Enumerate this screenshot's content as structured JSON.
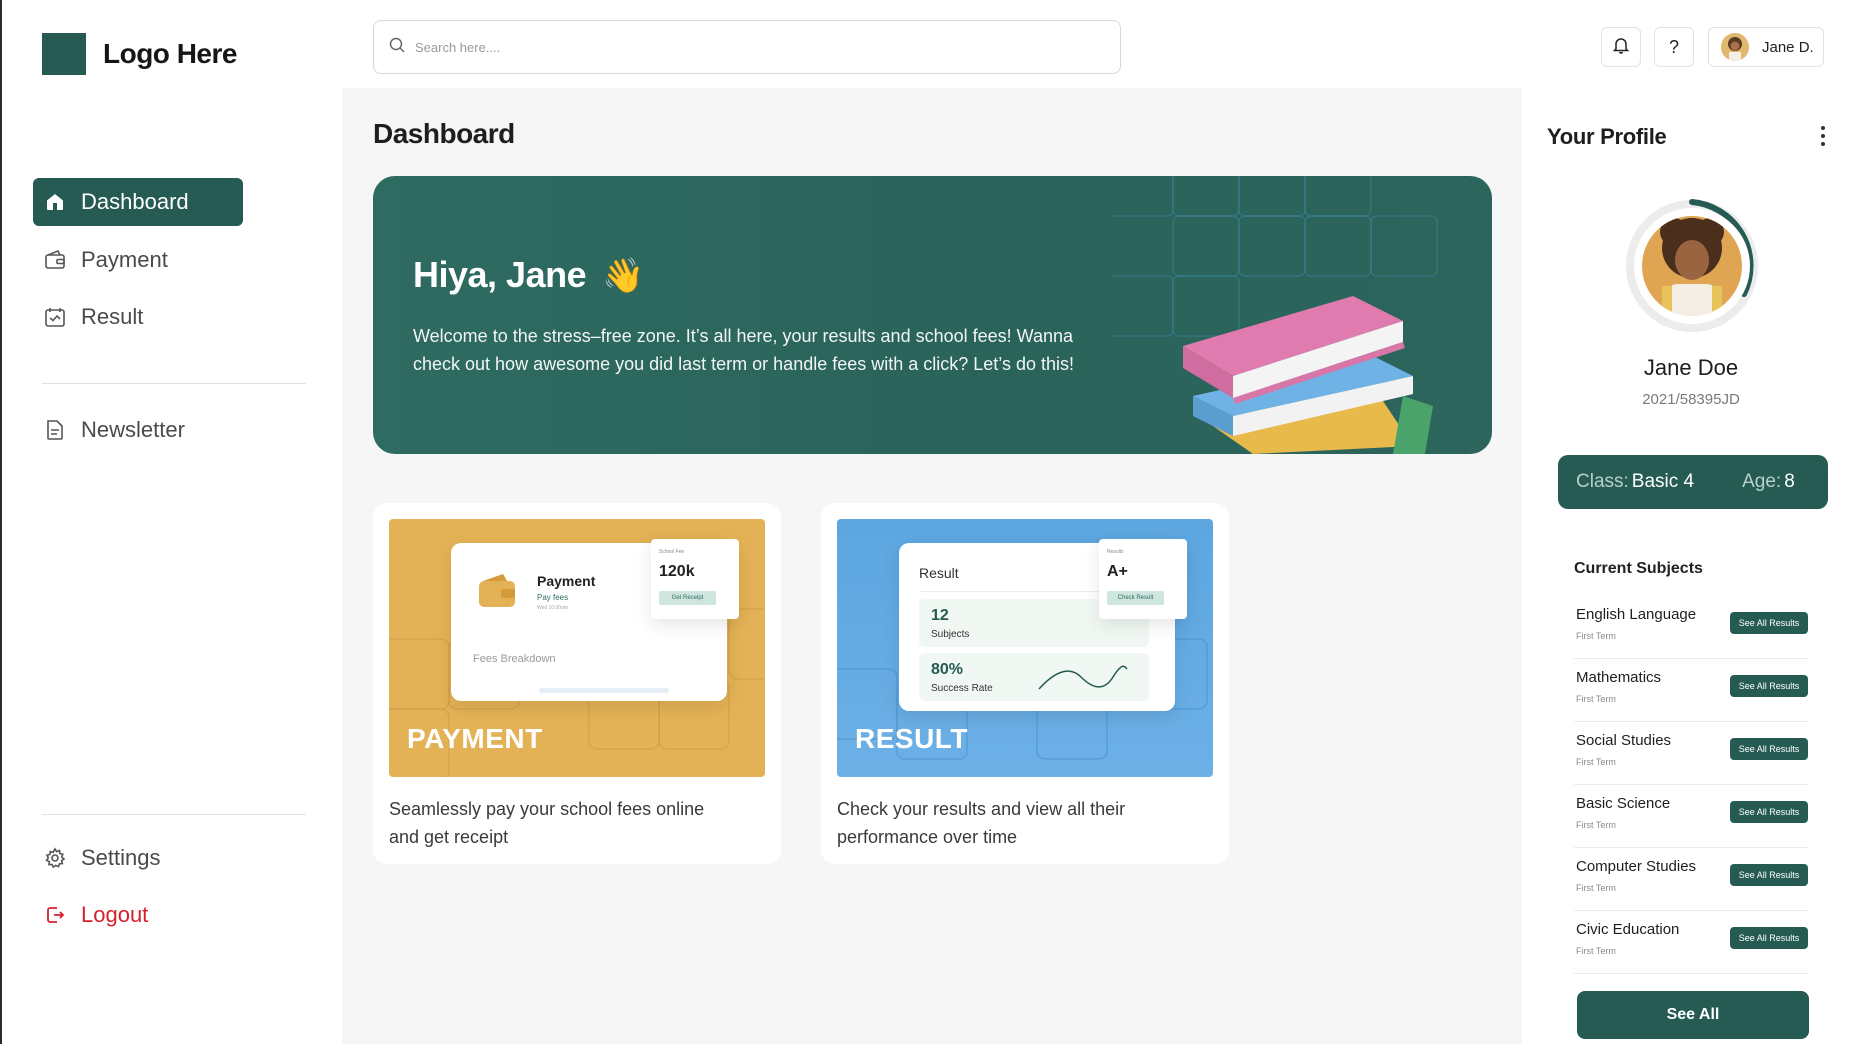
{
  "brand": {
    "logo_text": "Logo Here",
    "accent": "#255b52",
    "logout_color": "#d8202f"
  },
  "sidebar": {
    "items": [
      {
        "label": "Dashboard",
        "icon": "home-icon",
        "active": true
      },
      {
        "label": "Payment",
        "icon": "wallet-icon"
      },
      {
        "label": "Result",
        "icon": "result-icon"
      },
      {
        "label": "Newsletter",
        "icon": "newsletter-icon"
      }
    ],
    "settings_label": "Settings",
    "logout_label": "Logout"
  },
  "search": {
    "placeholder": "Search here....",
    "value": ""
  },
  "topbar": {
    "help_label": "?",
    "user_name": "Jane D."
  },
  "main": {
    "title": "Dashboard",
    "hero": {
      "greeting": "Hiya, Jane",
      "emoji": "👋",
      "message": "Welcome to the stress–free zone. It’s all here, your results and school fees! Wanna check out how awesome you did last term or handle fees with a click? Let’s do this!"
    },
    "cards": [
      {
        "label": "PAYMENT",
        "description": "Seamlessly pay your school fees online and get receipt",
        "color": "#e4b256",
        "mini": {
          "title": "Payment",
          "subtitle": "Pay fees",
          "time": "Wed 10:00am",
          "breakdown": "Fees Breakdown",
          "amount_caption": "School Fee",
          "amount": "120k",
          "button": "Get Receipt"
        }
      },
      {
        "label": "RESULT",
        "description": "Check your results and view all their performance over time",
        "color": "#5fa8e1",
        "mini": {
          "title": "Result",
          "subjects_value": "12",
          "subjects_label": "Subjects",
          "rate_value": "80%",
          "rate_label": "Success Rate",
          "grade_caption": "Results",
          "grade": "A+",
          "button": "Check Result"
        }
      }
    ]
  },
  "profile": {
    "title": "Your Profile",
    "name": "Jane Doe",
    "id": "2021/58395JD",
    "class_label": "Class:",
    "class_value": "Basic 4",
    "age_label": "Age:",
    "age_value": "8",
    "subjects_title": "Current Subjects",
    "subjects": [
      {
        "name": "English Language",
        "term": "First Term",
        "button": "See All Results"
      },
      {
        "name": "Mathematics",
        "term": "First Term",
        "button": "See All Results"
      },
      {
        "name": "Social Studies",
        "term": "First Term",
        "button": "See All Results"
      },
      {
        "name": "Basic Science",
        "term": "First Term",
        "button": "See All Results"
      },
      {
        "name": "Computer Studies",
        "term": "First Term",
        "button": "See All Results"
      },
      {
        "name": "Civic Education",
        "term": "First Term",
        "button": "See All Results"
      }
    ],
    "see_all_label": "See All"
  }
}
